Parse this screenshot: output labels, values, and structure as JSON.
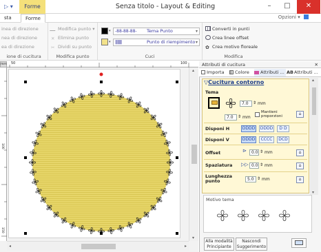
{
  "titlebar": {
    "context_tab": "Forme",
    "title": "Senza titolo - Layout & Editing",
    "qa_glyph": "▷ ▾",
    "minimize": "–",
    "maximize": "□",
    "close": "✕"
  },
  "tabs": {
    "left_tab": "sta",
    "active_tab": "Forme",
    "options": "Opzioni",
    "options_arrow": "▾"
  },
  "ribbon": {
    "group_direzione": {
      "items": [
        "inea di direzione",
        "nea di direzione",
        "ea di direzione"
      ],
      "label": "ione di cucitura"
    },
    "group_punto": {
      "items": [
        "Modifica punto",
        "Elimina punto",
        "Dividi su punto"
      ],
      "label": "Modifica punto"
    },
    "group_cuci": {
      "combo1": "Tema Punto",
      "combo1_pattern": "-88-88-88-",
      "combo2": "Punto di riempimento",
      "combo2_pattern": "|||||||||",
      "label": "Cuci"
    },
    "group_modifica": {
      "items": [
        "Converti in punti",
        "Crea linee offset",
        "Crea motivo floreale"
      ],
      "label": "Modifica"
    },
    "colors": {
      "color1": "#000000",
      "color2": "#f3e28a"
    }
  },
  "ruler": {
    "h_ticks": [
      "50",
      "100"
    ],
    "h_ticks_short": [
      "50",
      "100"
    ],
    "h_unit": "mm",
    "v_ticks": [
      "100",
      "150"
    ]
  },
  "canvas": {
    "fill_color": "#e7d66a",
    "outline_color": "#222222",
    "handle_color": "#000000",
    "rotate_handle_color": "#e02020"
  },
  "panel": {
    "title": "Attributi di cucitura",
    "close_glyph": "✕",
    "tabs": [
      "Importa",
      "Colore",
      "Attributi ...",
      "Attributi ..."
    ],
    "section_title": "Cucitura contorno",
    "tema_label": "Tema",
    "width_value": "7.0",
    "height_value": "7.0",
    "unit": "mm",
    "keep_prop_line1": "Mantieni",
    "keep_prop_line2": "proporzioni",
    "rows": [
      {
        "label": "Disponi H",
        "buttons": [
          "DDDD",
          "DDDD",
          "D D"
        ]
      },
      {
        "label": "Disponi V",
        "buttons": [
          "DDDD",
          "CCCC",
          "DCD"
        ]
      },
      {
        "label": "Offset",
        "value": "0.0",
        "unit": "mm"
      },
      {
        "label": "Spaziatura",
        "value": "0.0",
        "unit": "mm"
      },
      {
        "label_line1": "Lunghezza",
        "label_line2": "punto",
        "value": "5.0",
        "unit": "mm"
      }
    ],
    "motivo_label": "Motivo tema",
    "btn_principiante": [
      "Alla modalità",
      "Principiante"
    ],
    "btn_nascondi": [
      "Nascondi",
      "Suggerimento"
    ]
  }
}
